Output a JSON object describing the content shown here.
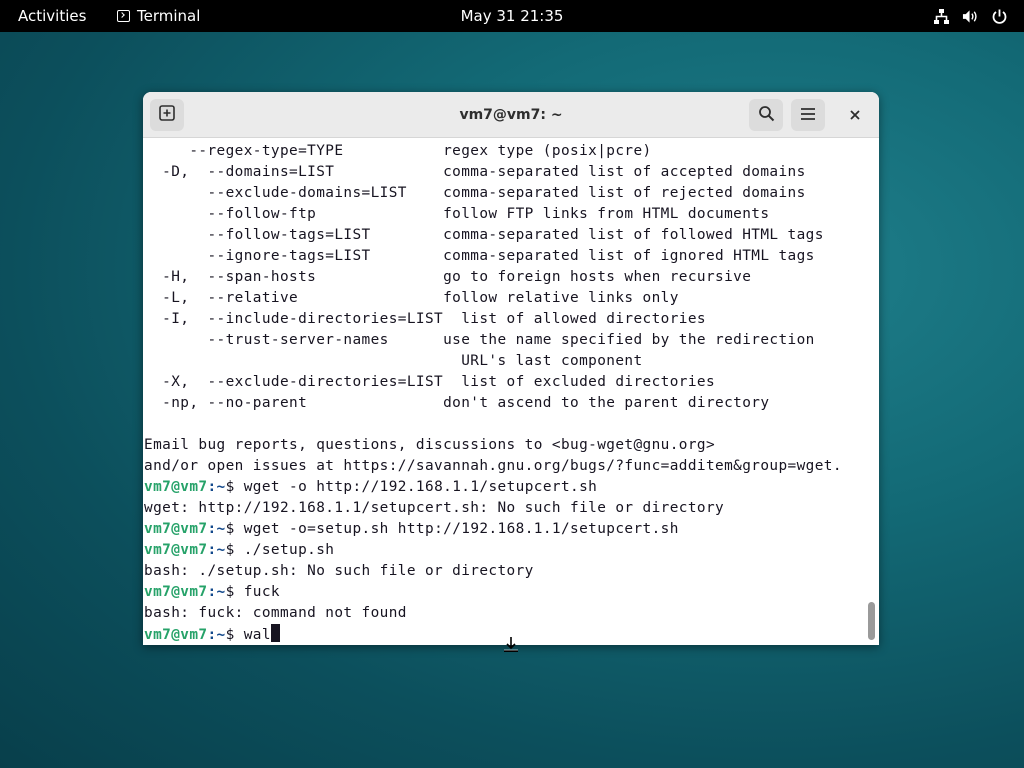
{
  "topbar": {
    "activities": "Activities",
    "app_name": "Terminal",
    "clock": "May 31  21:35",
    "tray_icons": [
      "network-icon",
      "volume-icon",
      "power-icon"
    ]
  },
  "window": {
    "title": "vm7@vm7: ~",
    "buttons": [
      "new-tab-icon",
      "search-icon",
      "menu-icon",
      "close-icon"
    ]
  },
  "colors": {
    "prompt_user": "#26a269",
    "prompt_path": "#12488b",
    "terminal_bg": "#ffffff",
    "terminal_fg": "#171421"
  },
  "terminal": {
    "lines": [
      {
        "text": "     --regex-type=TYPE           regex type (posix|pcre)"
      },
      {
        "text": "  -D,  --domains=LIST            comma-separated list of accepted domains"
      },
      {
        "text": "       --exclude-domains=LIST    comma-separated list of rejected domains"
      },
      {
        "text": "       --follow-ftp              follow FTP links from HTML documents"
      },
      {
        "text": "       --follow-tags=LIST        comma-separated list of followed HTML tags"
      },
      {
        "text": "       --ignore-tags=LIST        comma-separated list of ignored HTML tags"
      },
      {
        "text": "  -H,  --span-hosts              go to foreign hosts when recursive"
      },
      {
        "text": "  -L,  --relative                follow relative links only"
      },
      {
        "text": "  -I,  --include-directories=LIST  list of allowed directories"
      },
      {
        "text": "       --trust-server-names      use the name specified by the redirection"
      },
      {
        "text": "                                   URL's last component"
      },
      {
        "text": "  -X,  --exclude-directories=LIST  list of excluded directories"
      },
      {
        "text": "  -np, --no-parent               don't ascend to the parent directory"
      },
      {
        "text": ""
      },
      {
        "text": "Email bug reports, questions, discussions to <bug-wget@gnu.org>"
      },
      {
        "text": "and/or open issues at https://savannah.gnu.org/bugs/?func=additem&group=wget."
      },
      {
        "user": "vm7@vm7",
        "path": ":~",
        "cmd": "$ wget -o http://192.168.1.1/setupcert.sh"
      },
      {
        "text": "wget: http://192.168.1.1/setupcert.sh: No such file or directory"
      },
      {
        "user": "vm7@vm7",
        "path": ":~",
        "cmd": "$ wget -o=setup.sh http://192.168.1.1/setupcert.sh"
      },
      {
        "user": "vm7@vm7",
        "path": ":~",
        "cmd": "$ ./setup.sh"
      },
      {
        "text": "bash: ./setup.sh: No such file or directory"
      },
      {
        "user": "vm7@vm7",
        "path": ":~",
        "cmd": "$ fuck"
      },
      {
        "text": "bash: fuck: command not found"
      },
      {
        "user": "vm7@vm7",
        "path": ":~",
        "cmd": "$ wal",
        "cursor": true
      }
    ]
  }
}
